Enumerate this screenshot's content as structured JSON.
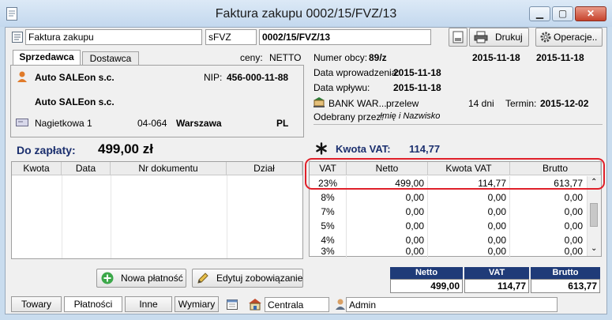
{
  "window": {
    "title": "Faktura zakupu 0002/15/FVZ/13"
  },
  "toolbar": {
    "doc_type": "Faktura zakupu",
    "series": "sFVZ",
    "number": "0002/15/FVZ/13",
    "print_label": "Drukuj",
    "operations_label": "Operacje.."
  },
  "tabs": {
    "seller": "Sprzedawca",
    "supplier": "Dostawca"
  },
  "prices_label": "ceny:",
  "prices_value": "NETTO",
  "seller": {
    "name1": "Auto SALEon s.c.",
    "nip_label": "NIP:",
    "nip": "456-000-11-88",
    "name2": "Auto SALEon s.c.",
    "street": "Nagietkowa 1",
    "postcode": "04-064",
    "city": "Warszawa",
    "country": "PL"
  },
  "document": {
    "external_no_label": "Numer obcy:",
    "external_no": "89/z",
    "date1": "2015-11-18",
    "date2": "2015-11-18",
    "entry_date_label": "Data wprowadzenia:",
    "entry_date": "2015-11-18",
    "receipt_date_label": "Data wpływu:",
    "receipt_date": "2015-11-18",
    "bank": "BANK WAR...",
    "payment_method": "przelew",
    "days": "14 dni",
    "term_label": "Termin:",
    "term": "2015-12-02",
    "received_by_label": "Odebrany przez:",
    "received_by": "Imię i Nazwisko"
  },
  "due": {
    "label": "Do zapłaty:",
    "amount": "499,00 zł"
  },
  "vat_summary": {
    "label": "Kwota VAT:",
    "amount": "114,77"
  },
  "payments_table": {
    "headers": [
      "Kwota",
      "Data",
      "Nr dokumentu",
      "Dział"
    ]
  },
  "vat_table": {
    "headers": [
      "VAT",
      "Netto",
      "Kwota VAT",
      "Brutto"
    ],
    "rows": [
      {
        "vat": "23%",
        "netto": "499,00",
        "kwota": "114,77",
        "brutto": "613,77"
      },
      {
        "vat": "8%",
        "netto": "0,00",
        "kwota": "0,00",
        "brutto": "0,00"
      },
      {
        "vat": "7%",
        "netto": "0,00",
        "kwota": "0,00",
        "brutto": "0,00"
      },
      {
        "vat": "5%",
        "netto": "0,00",
        "kwota": "0,00",
        "brutto": "0,00"
      },
      {
        "vat": "4%",
        "netto": "0,00",
        "kwota": "0,00",
        "brutto": "0,00"
      },
      {
        "vat": "3%",
        "netto": "0,00",
        "kwota": "0,00",
        "brutto": "0,00"
      }
    ]
  },
  "buttons": {
    "new_payment": "Nowa płatność",
    "edit_liability": "Edytuj zobowiązanie"
  },
  "totals": {
    "netto_label": "Netto",
    "netto": "499,00",
    "vat_label": "VAT",
    "vat": "114,77",
    "brutto_label": "Brutto",
    "brutto": "613,77"
  },
  "bottom_tabs": [
    "Towary",
    "Płatności",
    "Inne",
    "Wymiary"
  ],
  "status": {
    "branch": "Centrala",
    "user": "Admin"
  },
  "colors": {
    "accent_blue": "#1f3b78",
    "highlight_red": "#e0202a",
    "title_blue": "#1b2f6e"
  }
}
